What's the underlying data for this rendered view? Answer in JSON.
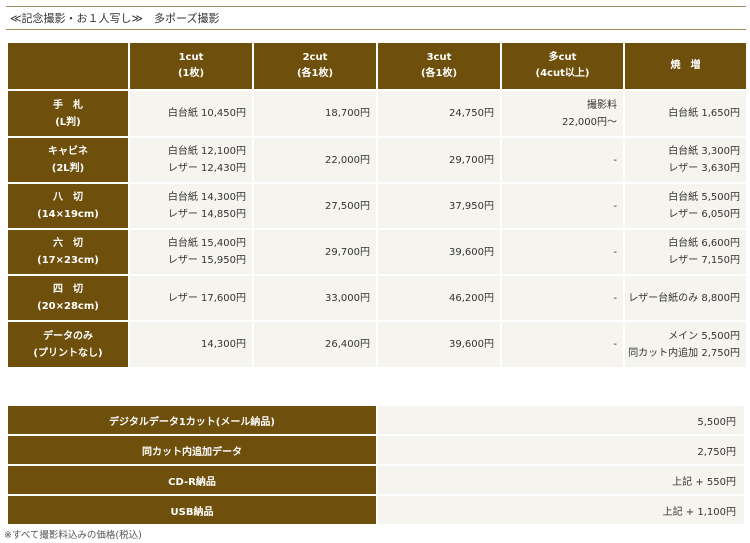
{
  "title": "≪記念撮影・お１人写し≫　多ポーズ撮影",
  "price_table": {
    "headers": [
      [
        "",
        ""
      ],
      [
        "1cut",
        "(1枚)"
      ],
      [
        "2cut",
        "(各1枚)"
      ],
      [
        "3cut",
        "(各1枚)"
      ],
      [
        "多cut",
        "(4cut以上)"
      ],
      [
        "焼　増",
        ""
      ]
    ],
    "rows": [
      {
        "label": [
          "手　札",
          "(L判)"
        ],
        "cells": [
          [
            "白台紙 10,450円"
          ],
          [
            "18,700円"
          ],
          [
            "24,750円"
          ],
          [
            "撮影料",
            "22,000円〜"
          ],
          [
            "白台紙 1,650円"
          ]
        ]
      },
      {
        "label": [
          "キャビネ",
          "(2L判)"
        ],
        "cells": [
          [
            "白台紙 12,100円",
            "レザー 12,430円"
          ],
          [
            "22,000円"
          ],
          [
            "29,700円"
          ],
          [
            "-"
          ],
          [
            "白台紙 3,300円",
            "レザー 3,630円"
          ]
        ]
      },
      {
        "label": [
          "八　切",
          "(14×19cm)"
        ],
        "cells": [
          [
            "白台紙 14,300円",
            "レザー 14,850円"
          ],
          [
            "27,500円"
          ],
          [
            "37,950円"
          ],
          [
            "-"
          ],
          [
            "白台紙 5,500円",
            "レザー 6,050円"
          ]
        ]
      },
      {
        "label": [
          "六　切",
          "(17×23cm)"
        ],
        "cells": [
          [
            "白台紙 15,400円",
            "レザー 15,950円"
          ],
          [
            "29,700円"
          ],
          [
            "39,600円"
          ],
          [
            "-"
          ],
          [
            "白台紙 6,600円",
            "レザー 7,150円"
          ]
        ]
      },
      {
        "label": [
          "四　切",
          "(20×28cm)"
        ],
        "cells": [
          [
            "レザー 17,600円"
          ],
          [
            "33,000円"
          ],
          [
            "46,200円"
          ],
          [
            "-"
          ],
          [
            "レザー台紙のみ 8,800円"
          ]
        ]
      },
      {
        "label": [
          "データのみ",
          "(プリントなし)"
        ],
        "cells": [
          [
            "14,300円"
          ],
          [
            "26,400円"
          ],
          [
            "39,600円"
          ],
          [
            "-"
          ],
          [
            "メイン 5,500円",
            "同カット内追加 2,750円"
          ]
        ]
      }
    ]
  },
  "digital_table": [
    {
      "label": "デジタルデータ1カット(メール納品)",
      "price": "5,500円"
    },
    {
      "label": "同カット内追加データ",
      "price": "2,750円"
    },
    {
      "label": "CD-R納品",
      "price": "上記 + 550円"
    },
    {
      "label": "USB納品",
      "price": "上記 + 1,100円"
    }
  ],
  "note": "※すべて撮影料込みの価格(税込)",
  "colors": {
    "header_bg": "#6e4f0b",
    "cell_bg": "#f6f4ee"
  }
}
